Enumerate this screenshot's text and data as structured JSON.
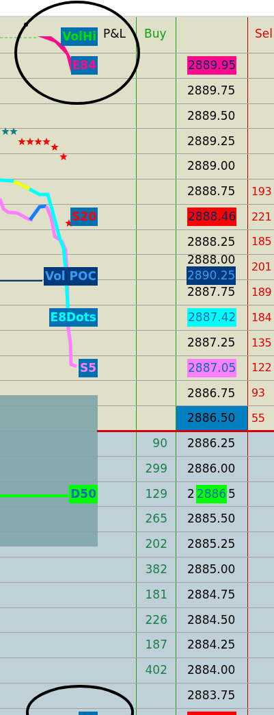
{
  "header": {
    "pnl": "P&L",
    "buy": "Buy",
    "sell": "Sel",
    "chart_label": {
      "kind": "boxed",
      "text": "VolHi",
      "color": "#00e000"
    }
  },
  "rows": [
    {
      "kind": "ask",
      "highlighted": false,
      "marker": {
        "text": "2889.95",
        "color": "#ff0a8c"
      },
      "chart_label": {
        "kind": "boxed",
        "text": "E84",
        "color": "#ff0a8c"
      }
    },
    {
      "kind": "ask",
      "highlighted": false,
      "price": "2889.75"
    },
    {
      "kind": "ask",
      "highlighted": false,
      "price": "2889.50"
    },
    {
      "kind": "ask",
      "highlighted": false,
      "price": "2889.25"
    },
    {
      "kind": "ask",
      "highlighted": false,
      "price": "2889.00"
    },
    {
      "kind": "ask",
      "highlighted": false,
      "price": "2888.75",
      "sell": "193"
    },
    {
      "kind": "ask",
      "highlighted": false,
      "marker": {
        "text": "2888.46",
        "color": "#ff0000"
      },
      "sell": "221",
      "chart_label": {
        "kind": "boxed",
        "text": "S20",
        "color": "#ff0000"
      }
    },
    {
      "kind": "ask",
      "highlighted": false,
      "price": "2888.25",
      "sell": "185"
    },
    {
      "kind": "ask",
      "highlighted": false,
      "price": "2888.00",
      "marker": {
        "text": "2890.25",
        "color": "#003a7a"
      },
      "sell": "201",
      "chart_label": {
        "kind": "solid",
        "text": "Vol POC",
        "color": "#003a7a"
      }
    },
    {
      "kind": "ask",
      "highlighted": false,
      "price": "2887.75",
      "sell": "189"
    },
    {
      "kind": "ask",
      "highlighted": false,
      "marker": {
        "text": "2887.42",
        "color": "#00ffff"
      },
      "sell": "184",
      "chart_label": {
        "kind": "boxed",
        "text": "E8Dots",
        "color": "#00ffff"
      }
    },
    {
      "kind": "ask",
      "highlighted": false,
      "price": "2887.25",
      "sell": "135"
    },
    {
      "kind": "ask",
      "highlighted": false,
      "marker": {
        "text": "2887.05",
        "color": "#ff80ff"
      },
      "sell": "122",
      "chart_label": {
        "kind": "boxed",
        "text": "S5",
        "color": "#ff80ff"
      }
    },
    {
      "kind": "ask",
      "highlighted": false,
      "price": "2886.75",
      "sell": "93"
    },
    {
      "kind": "ask",
      "highlighted": true,
      "price": "2886.50",
      "sell": "55"
    },
    {
      "kind": "bid",
      "highlighted": false,
      "price": "2886.25",
      "buy": "90"
    },
    {
      "kind": "bid",
      "highlighted": false,
      "price": "2886.00",
      "buy": "299"
    },
    {
      "kind": "bid",
      "highlighted": false,
      "price_pre": "2",
      "price_post": "5",
      "marker": {
        "text": "2886",
        "color": "#00ff00"
      },
      "buy": "129",
      "chart_label": {
        "kind": "solid",
        "text": "D50",
        "color": "#00ff00"
      }
    },
    {
      "kind": "bid",
      "highlighted": false,
      "price": "2885.50",
      "buy": "265"
    },
    {
      "kind": "bid",
      "highlighted": false,
      "price": "2885.25",
      "buy": "202"
    },
    {
      "kind": "bid",
      "highlighted": false,
      "price": "2885.00",
      "buy": "382"
    },
    {
      "kind": "bid",
      "highlighted": false,
      "price": "2884.75",
      "buy": "181"
    },
    {
      "kind": "bid",
      "highlighted": false,
      "price": "2884.50",
      "buy": "226"
    },
    {
      "kind": "bid",
      "highlighted": false,
      "price": "2884.25",
      "buy": "187"
    },
    {
      "kind": "bid",
      "highlighted": false,
      "price": "2884.00",
      "buy": "402"
    },
    {
      "kind": "bid",
      "highlighted": false,
      "price": "2883.75"
    },
    {
      "kind": "bid",
      "highlighted": false,
      "marker": {
        "color": "#ff0000"
      },
      "chart_label": {
        "kind": "boxed"
      }
    }
  ]
}
